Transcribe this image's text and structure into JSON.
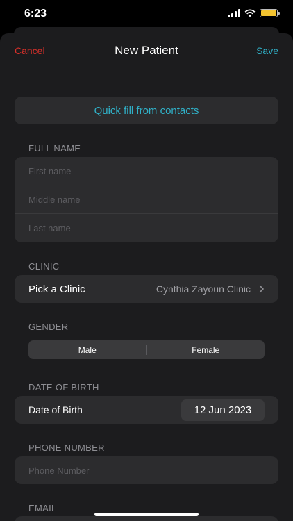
{
  "status": {
    "time": "6:23"
  },
  "nav": {
    "cancel": "Cancel",
    "title": "New Patient",
    "save": "Save"
  },
  "quick_fill": "Quick fill from contacts",
  "full_name": {
    "label": "FULL NAME",
    "first_placeholder": "First name",
    "middle_placeholder": "Middle name",
    "last_placeholder": "Last name"
  },
  "clinic": {
    "label": "CLINIC",
    "row_label": "Pick a Clinic",
    "value": "Cynthia Zayoun Clinic"
  },
  "gender": {
    "label": "GENDER",
    "options": [
      "Male",
      "Female"
    ]
  },
  "dob": {
    "label": "DATE OF BIRTH",
    "row_label": "Date of Birth",
    "value": "12 Jun 2023"
  },
  "phone": {
    "label": "PHONE NUMBER",
    "placeholder": "Phone Number"
  },
  "email": {
    "label": "EMAIL"
  },
  "colors": {
    "accent": "#30b0c7",
    "cancel": "#d9302a",
    "battery": "#f4c430"
  }
}
